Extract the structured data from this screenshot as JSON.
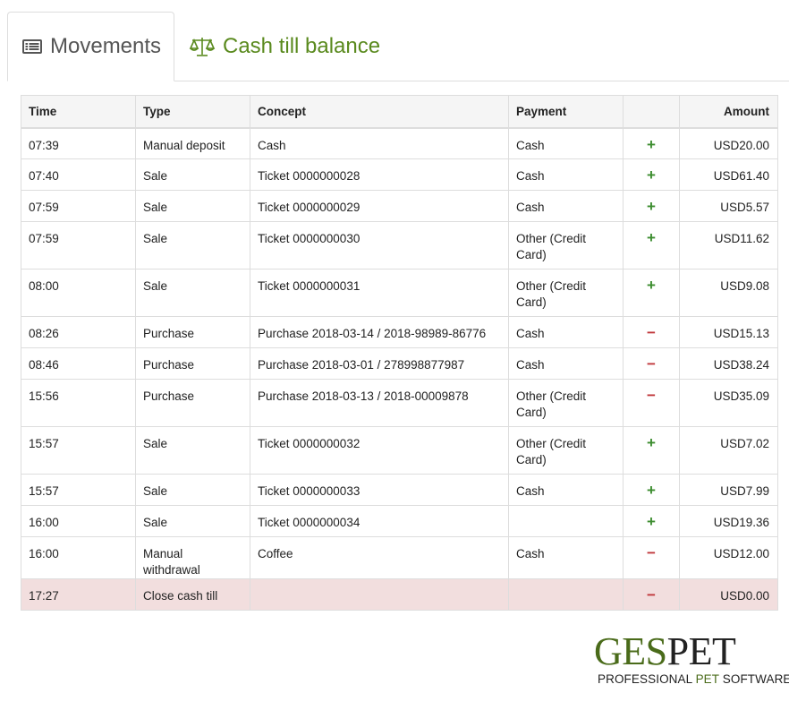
{
  "tabs": {
    "movements": {
      "label": "Movements",
      "icon": "list-alt-icon"
    },
    "balance": {
      "label": "Cash till balance",
      "icon": "scale-icon"
    }
  },
  "colors": {
    "accent": "#5a8a1e",
    "plus": "#3c8d2f",
    "minus": "#c0363a",
    "closing_row": "#f2dede"
  },
  "table": {
    "headers": {
      "time": "Time",
      "type": "Type",
      "concept": "Concept",
      "payment": "Payment",
      "sign": "",
      "amount": "Amount"
    },
    "rows": [
      {
        "time": "07:39",
        "type": "Manual deposit",
        "concept": "Cash",
        "payment": "Cash",
        "sign": "+",
        "amount": "USD20.00"
      },
      {
        "time": "07:40",
        "type": "Sale",
        "concept": "Ticket 0000000028",
        "payment": "Cash",
        "sign": "+",
        "amount": "USD61.40"
      },
      {
        "time": "07:59",
        "type": "Sale",
        "concept": "Ticket 0000000029",
        "payment": "Cash",
        "sign": "+",
        "amount": "USD5.57"
      },
      {
        "time": "07:59",
        "type": "Sale",
        "concept": "Ticket 0000000030",
        "payment": "Other (Credit Card)",
        "sign": "+",
        "amount": "USD11.62"
      },
      {
        "time": "08:00",
        "type": "Sale",
        "concept": "Ticket 0000000031",
        "payment": "Other (Credit Card)",
        "sign": "+",
        "amount": "USD9.08"
      },
      {
        "time": "08:26",
        "type": "Purchase",
        "concept": "Purchase 2018-03-14 / 2018-98989-86776",
        "payment": "Cash",
        "sign": "−",
        "amount": "USD15.13"
      },
      {
        "time": "08:46",
        "type": "Purchase",
        "concept": "Purchase 2018-03-01 / 278998877987",
        "payment": "Cash",
        "sign": "−",
        "amount": "USD38.24"
      },
      {
        "time": "15:56",
        "type": "Purchase",
        "concept": "Purchase 2018-03-13 / 2018-00009878",
        "payment": "Other (Credit Card)",
        "sign": "−",
        "amount": "USD35.09"
      },
      {
        "time": "15:57",
        "type": "Sale",
        "concept": "Ticket 0000000032",
        "payment": "Other (Credit Card)",
        "sign": "+",
        "amount": "USD7.02"
      },
      {
        "time": "15:57",
        "type": "Sale",
        "concept": "Ticket 0000000033",
        "payment": "Cash",
        "sign": "+",
        "amount": "USD7.99"
      },
      {
        "time": "16:00",
        "type": "Sale",
        "concept": "Ticket 0000000034",
        "payment": "",
        "sign": "+",
        "amount": "USD19.36"
      },
      {
        "time": "16:00",
        "type": "Manual withdrawal",
        "concept": "Coffee",
        "payment": "Cash",
        "sign": "−",
        "amount": "USD12.00"
      },
      {
        "time": "17:27",
        "type": "Close cash till",
        "concept": "",
        "payment": "",
        "sign": "−",
        "amount": "USD0.00"
      }
    ]
  },
  "logo": {
    "main_a": "GES",
    "main_b": "PET",
    "sub_a": "PROFESSIONAL ",
    "sub_b": "PET",
    "sub_c": " SOFTWARE"
  }
}
